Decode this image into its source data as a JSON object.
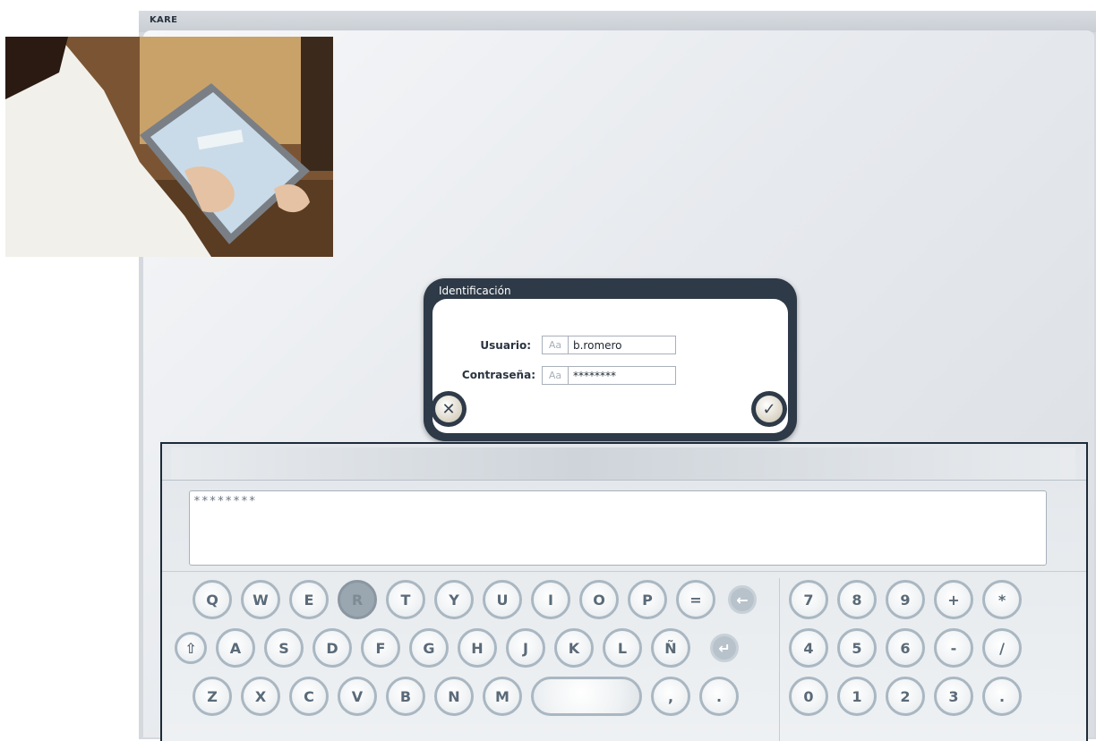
{
  "app": {
    "title": "KARE"
  },
  "photo": {
    "description_icon": "photo"
  },
  "dialog": {
    "title": "Identificación",
    "user_label": "Usuario:",
    "user_type_hint": "Aa",
    "user_value": "b.romero",
    "password_label": "Contraseña:",
    "password_type_hint": "Aa",
    "password_value": "********",
    "cancel_icon": "close-icon",
    "cancel_glyph": "✕",
    "confirm_icon": "check-icon",
    "confirm_glyph": "✓"
  },
  "keyboard": {
    "text_value": "********",
    "row1": [
      "Q",
      "W",
      "E",
      "R",
      "T",
      "Y",
      "U",
      "I",
      "O",
      "P",
      "="
    ],
    "row2": [
      "A",
      "S",
      "D",
      "F",
      "G",
      "H",
      "J",
      "K",
      "L",
      "Ñ"
    ],
    "row3": [
      "Z",
      "X",
      "C",
      "V",
      "B",
      "N",
      "M",
      "",
      ",",
      "."
    ],
    "numpad_row1": [
      "7",
      "8",
      "9",
      "+",
      "*"
    ],
    "numpad_row2": [
      "4",
      "5",
      "6",
      "-",
      "/"
    ],
    "numpad_row3": [
      "0",
      "1",
      "2",
      "3",
      "."
    ],
    "active_key": "R",
    "backspace_glyph": "←",
    "enter_glyph": "↵",
    "shift_glyph": "⇧"
  },
  "colors": {
    "dialog_frame": "#2e3a48",
    "key_border": "#a9b7c2",
    "active_key": "#9aa6b0"
  }
}
